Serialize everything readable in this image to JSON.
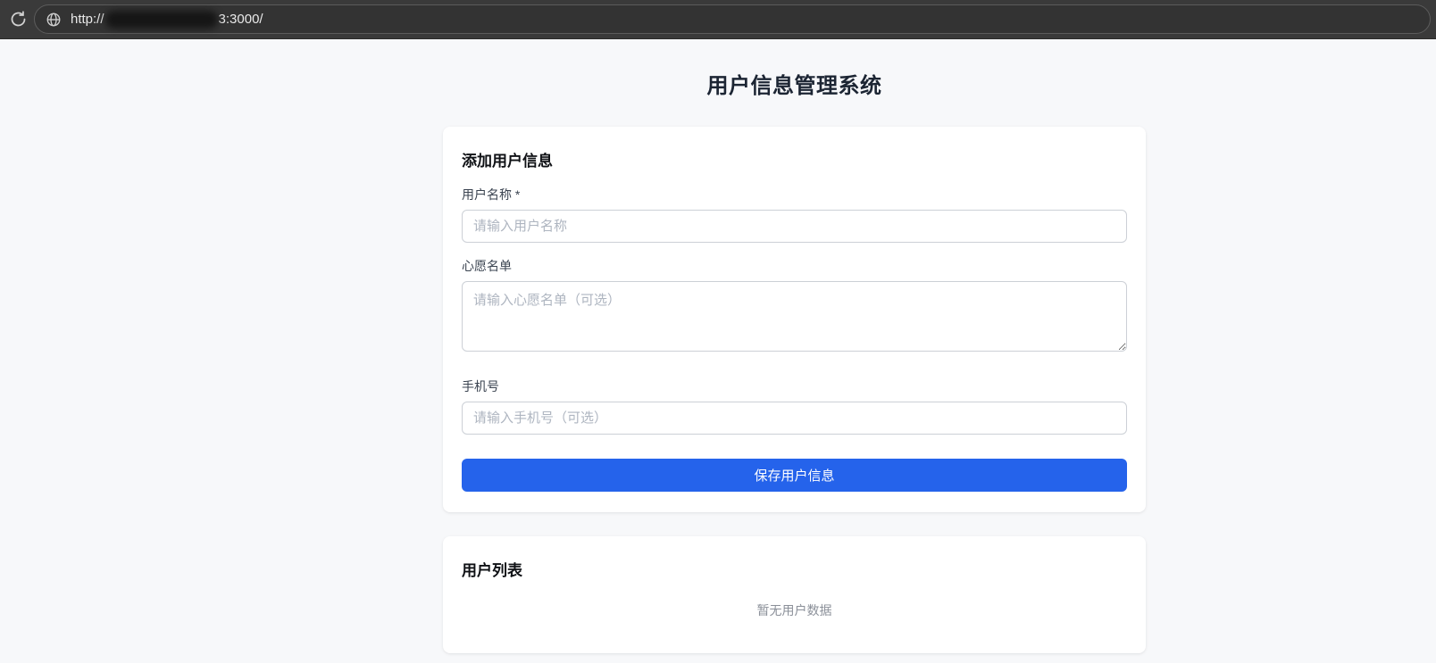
{
  "browser": {
    "url_prefix": "http://",
    "url_suffix": "3:3000/"
  },
  "page": {
    "title": "用户信息管理系统"
  },
  "form_card": {
    "heading": "添加用户信息",
    "fields": [
      {
        "label": "用户名称 *",
        "placeholder": "请输入用户名称"
      },
      {
        "label": "心愿名单",
        "placeholder": "请输入心愿名单（可选）"
      },
      {
        "label": "手机号",
        "placeholder": "请输入手机号（可选）"
      }
    ],
    "submit_label": "保存用户信息"
  },
  "list_card": {
    "heading": "用户列表",
    "empty_text": "暂无用户数据"
  },
  "colors": {
    "accent": "#2563eb",
    "topbar_bg": "#3a3a3a",
    "page_bg": "#f7f8fa",
    "title_color": "#1c2533"
  }
}
